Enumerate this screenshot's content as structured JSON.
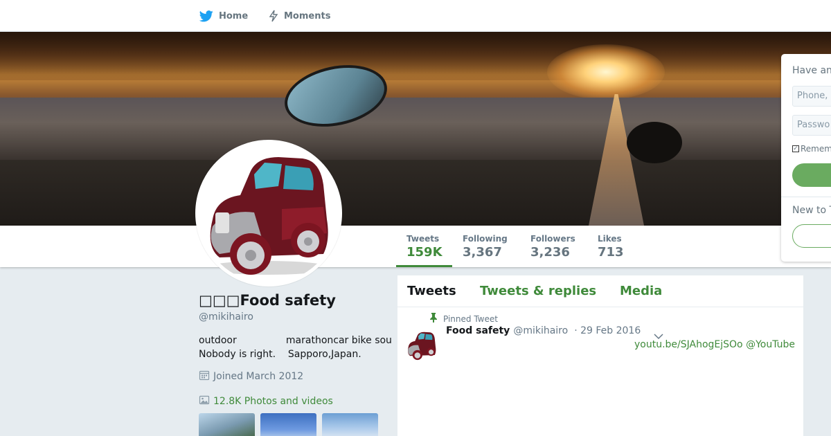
{
  "nav": {
    "home_label": "Home",
    "moments_label": "Moments"
  },
  "colors": {
    "accent": "#3f8a3a",
    "nav_icon": "#1da1f2",
    "login_button": "#6aab60"
  },
  "login_panel": {
    "have_account": "Have an",
    "phone_placeholder": "Phone,",
    "password_placeholder": "Passwo",
    "remember": "Remem",
    "new_to": "New to T"
  },
  "stats": [
    {
      "label": "Tweets",
      "value": "159K"
    },
    {
      "label": "Following",
      "value": "3,367"
    },
    {
      "label": "Followers",
      "value": "3,236"
    },
    {
      "label": "Likes",
      "value": "713"
    }
  ],
  "profile": {
    "name": "□□□Food safety",
    "handle": "@mikihairo",
    "bio_line1": "outdoor                marathoncar bike sou",
    "bio_line2": "Nobody is right.    Sapporo,Japan.",
    "joined": "Joined March 2012",
    "photos_videos": "12.8K Photos and videos"
  },
  "timeline": {
    "tabs": [
      {
        "label": "Tweets"
      },
      {
        "label": "Tweets & replies"
      },
      {
        "label": "Media"
      }
    ],
    "pinned_label": "Pinned Tweet",
    "tweet": {
      "name": "Food safety",
      "handle": "@mikihairo",
      "date": "· 29 Feb 2016",
      "link_text": "youtu.be/SJAhogEjSOo @YouTube"
    }
  }
}
